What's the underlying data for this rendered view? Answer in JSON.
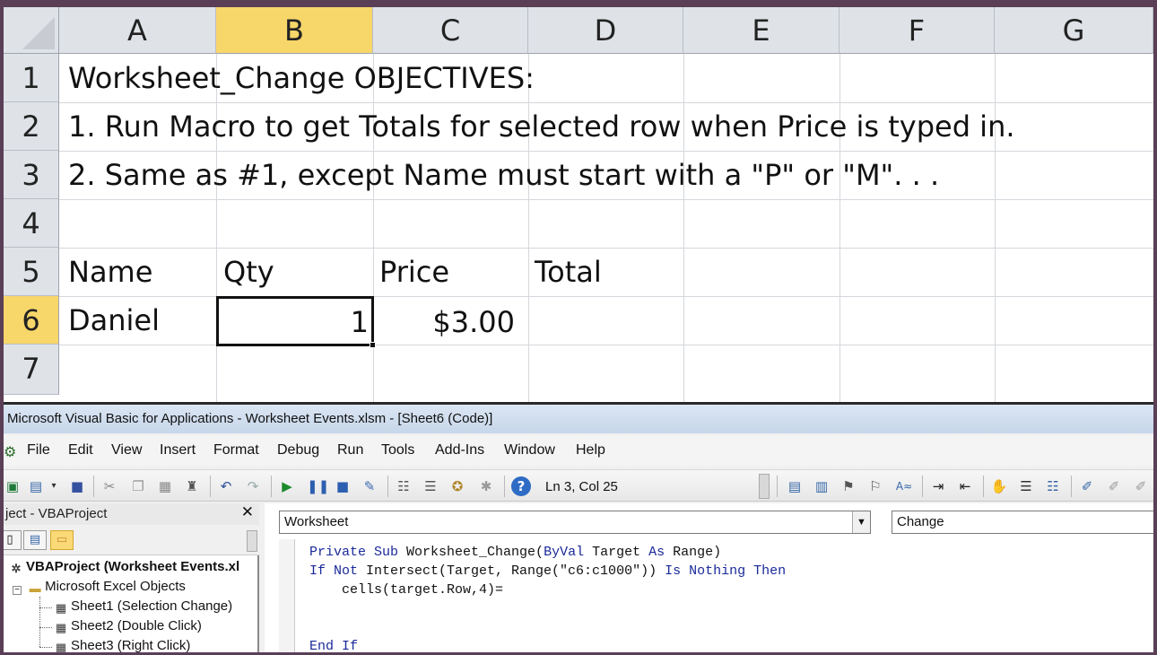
{
  "sheet": {
    "columns": [
      "A",
      "B",
      "C",
      "D",
      "E",
      "F",
      "G"
    ],
    "rows": [
      "1",
      "2",
      "3",
      "4",
      "5",
      "6",
      "7"
    ],
    "cells": {
      "a1": "Worksheet_Change OBJECTIVES:",
      "a2": "1. Run Macro to get Totals for selected row when Price is typed in.",
      "a3": "2. Same as #1, except Name must start with a \"P\" or \"M\". . .",
      "a5": "Name",
      "b5": "Qty",
      "c5": "Price",
      "d5": "Total",
      "a6": "Daniel",
      "b6": "1",
      "c6": "$3.00"
    },
    "selected_column": "B",
    "selected_row": "6",
    "colors": {
      "header": "#dfe3e8",
      "selected_header": "#f7d66a"
    }
  },
  "vbe": {
    "title": "Microsoft Visual Basic for Applications - Worksheet Events.xlsm - [Sheet6 (Code)]",
    "menu": [
      "File",
      "Edit",
      "View",
      "Insert",
      "Format",
      "Debug",
      "Run",
      "Tools",
      "Add-Ins",
      "Window",
      "Help"
    ],
    "status": "Ln 3, Col 25",
    "project": {
      "title": "ject - VBAProject",
      "root": "VBAProject (Worksheet Events.xl",
      "folder": "Microsoft Excel Objects",
      "sheets": [
        "Sheet1 (Selection Change)",
        "Sheet2 (Double Click)",
        "Sheet3 (Right Click)"
      ]
    },
    "object_dropdown": "Worksheet",
    "procedure_dropdown": "Change",
    "code": {
      "line1_kw1": "Private Sub",
      "line1_mid": " Worksheet_Change(",
      "line1_kw2": "ByVal",
      "line1_mid2": " Target ",
      "line1_kw3": "As",
      "line1_end": " Range)",
      "line2_kw1": "If Not",
      "line2_mid": " Intersect(Target, Range(\"c6:c1000\")) ",
      "line2_kw2": "Is Nothing Then",
      "line3": "    cells(target.Row,4)=",
      "line6": "End If"
    },
    "icons": [
      "excel-icon",
      "form-icon",
      "save-icon",
      "cut-icon",
      "copy-icon",
      "paste-icon",
      "find-icon",
      "undo-icon",
      "redo-icon",
      "run-icon",
      "break-icon",
      "reset-icon",
      "design-mode-icon",
      "project-explorer-icon",
      "properties-icon",
      "object-browser-icon",
      "toolbox-icon",
      "help-icon"
    ]
  }
}
